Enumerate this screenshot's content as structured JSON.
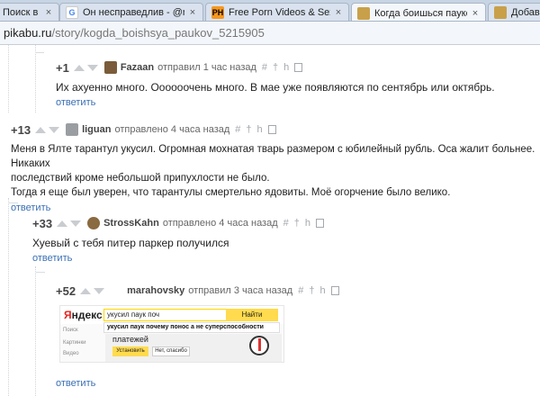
{
  "browser": {
    "tabs": [
      {
        "title": "Поиск в G",
        "favicon": "google-icon",
        "active": false
      },
      {
        "title": "Он несправедлив - @m",
        "favicon": "google-icon",
        "active": false
      },
      {
        "title": "Free Porn Videos & Sex M",
        "favicon": "ph-icon",
        "active": false
      },
      {
        "title": "Когда боишься пауков",
        "favicon": "pikabu-icon",
        "active": true
      },
      {
        "title": "Добави",
        "favicon": "pikabu-icon",
        "active": false
      }
    ],
    "close_glyph": "×",
    "url_host": "pikabu.ru",
    "url_path": "/story/kogda_boishsya_paukov_5215905"
  },
  "comments": [
    {
      "rating": "+1",
      "author": "Fazaan",
      "time": "отправил 1 час назад",
      "text_lines": [
        "Их ахуенно много. Оооооочень много. В мае уже появляются по сентябрь или октябрь."
      ],
      "reply": "ответить"
    },
    {
      "rating": "+13",
      "author": "liguan",
      "time": "отправлено 4 часа назад",
      "text_lines": [
        "Меня в Ялте тарантул укусил. Огромная мохнатая тварь размером с юбилейный рубль. Оса жалит больнее. Никаких",
        "последствий кроме небольшой припухлости не было.",
        "Тогда я еще был уверен, что тарантулы смертельно ядовиты. Моё огорчение было велико."
      ],
      "reply": "ответить"
    },
    {
      "rating": "+33",
      "author": "StrossKahn",
      "time": "отправлено 4 часа назад",
      "text_lines": [
        "Хуевый с тебя питер паркер получился"
      ],
      "reply": "ответить"
    },
    {
      "rating": "+52",
      "author": "marahovsky",
      "time": "отправил 3 часа назад",
      "text_lines": [],
      "reply": "ответить"
    }
  ],
  "tools": {
    "hash": "#",
    "dagger": "†",
    "h": "h"
  },
  "embedded_image": {
    "logo_red": "Я",
    "logo_rest": "ндекс",
    "query": "укусил паук поч",
    "search_button": "Найти",
    "suggestion": "укусил паук почему понос а не суперспособности",
    "side_links": [
      "Поиск",
      "Картинки",
      "Видео"
    ],
    "pane_title": "платежей",
    "btn_install": "Установить",
    "btn_no": "Нет, спасибо"
  },
  "colors": {
    "link": "#3a6fb5",
    "tab_strip": "#c7d4e3",
    "yandex_yellow": "#ffdb4d"
  }
}
